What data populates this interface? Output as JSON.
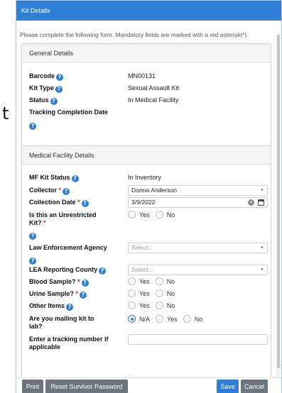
{
  "background": {
    "fragment": "t"
  },
  "dialog": {
    "title": "Kit Details",
    "intro": "Please complete the following form. Mandatory fields are marked with a red asterisk(*)"
  },
  "general": {
    "heading": "General Details",
    "barcode_label": "Barcode",
    "barcode_value": "MN00131",
    "kit_type_label": "Kit Type",
    "kit_type_value": "Sexual Assault Kit",
    "status_label": "Status",
    "status_value": "In Medical Facility",
    "tracking_label": "Tracking Completion Date",
    "tracking_value": ""
  },
  "medical": {
    "heading": "Medical Facility Details",
    "mf_status_label": "MF Kit Status",
    "mf_status_value": "In Inventory",
    "collector_label": "Collector",
    "collector_value": "Donna Anderson",
    "collection_date_label": "Collection Date",
    "collection_date_value": "3/9/2022",
    "unrestricted_label_1": "Is this an Unrestricted",
    "unrestricted_label_2": "Kit?",
    "unrestricted_options": [
      "Yes",
      "No"
    ],
    "lea_label": "Law Enforcement Agency",
    "lea_placeholder": "Select...",
    "lea_county_label": "LEA Reporting County",
    "lea_county_placeholder": "Select...",
    "blood_label": "Blood Sample?",
    "blood_options": [
      "Yes",
      "No"
    ],
    "urine_label": "Urine Sample?",
    "urine_options": [
      "Yes",
      "No"
    ],
    "other_label": "Other Items",
    "other_options": [
      "Yes",
      "No"
    ],
    "mailing_label_1": "Are you mailing kit to",
    "mailing_label_2": "lab?",
    "mailing_options": [
      "N/A",
      "Yes",
      "No"
    ],
    "mailing_selected": "N/A",
    "tracking_number_label_1": "Enter a tracking number if",
    "tracking_number_label_2": "applicable",
    "tracking_number_value": ""
  },
  "common": {
    "asterisk": "*",
    "help_glyph": "?",
    "caret": "▸",
    "clear_glyph": "×"
  },
  "footer": {
    "print_label": "Print",
    "reset_label": "Reset Survivor Password",
    "save_label": "Save",
    "cancel_label": "Cancel"
  },
  "colors": {
    "primary": "#2e7fd5",
    "required": "#d9211f",
    "secondary_button": "#6c757d"
  },
  "icons": [
    "help-icon",
    "caret-icon",
    "clear-icon",
    "calendar-icon",
    "radio-icon"
  ]
}
